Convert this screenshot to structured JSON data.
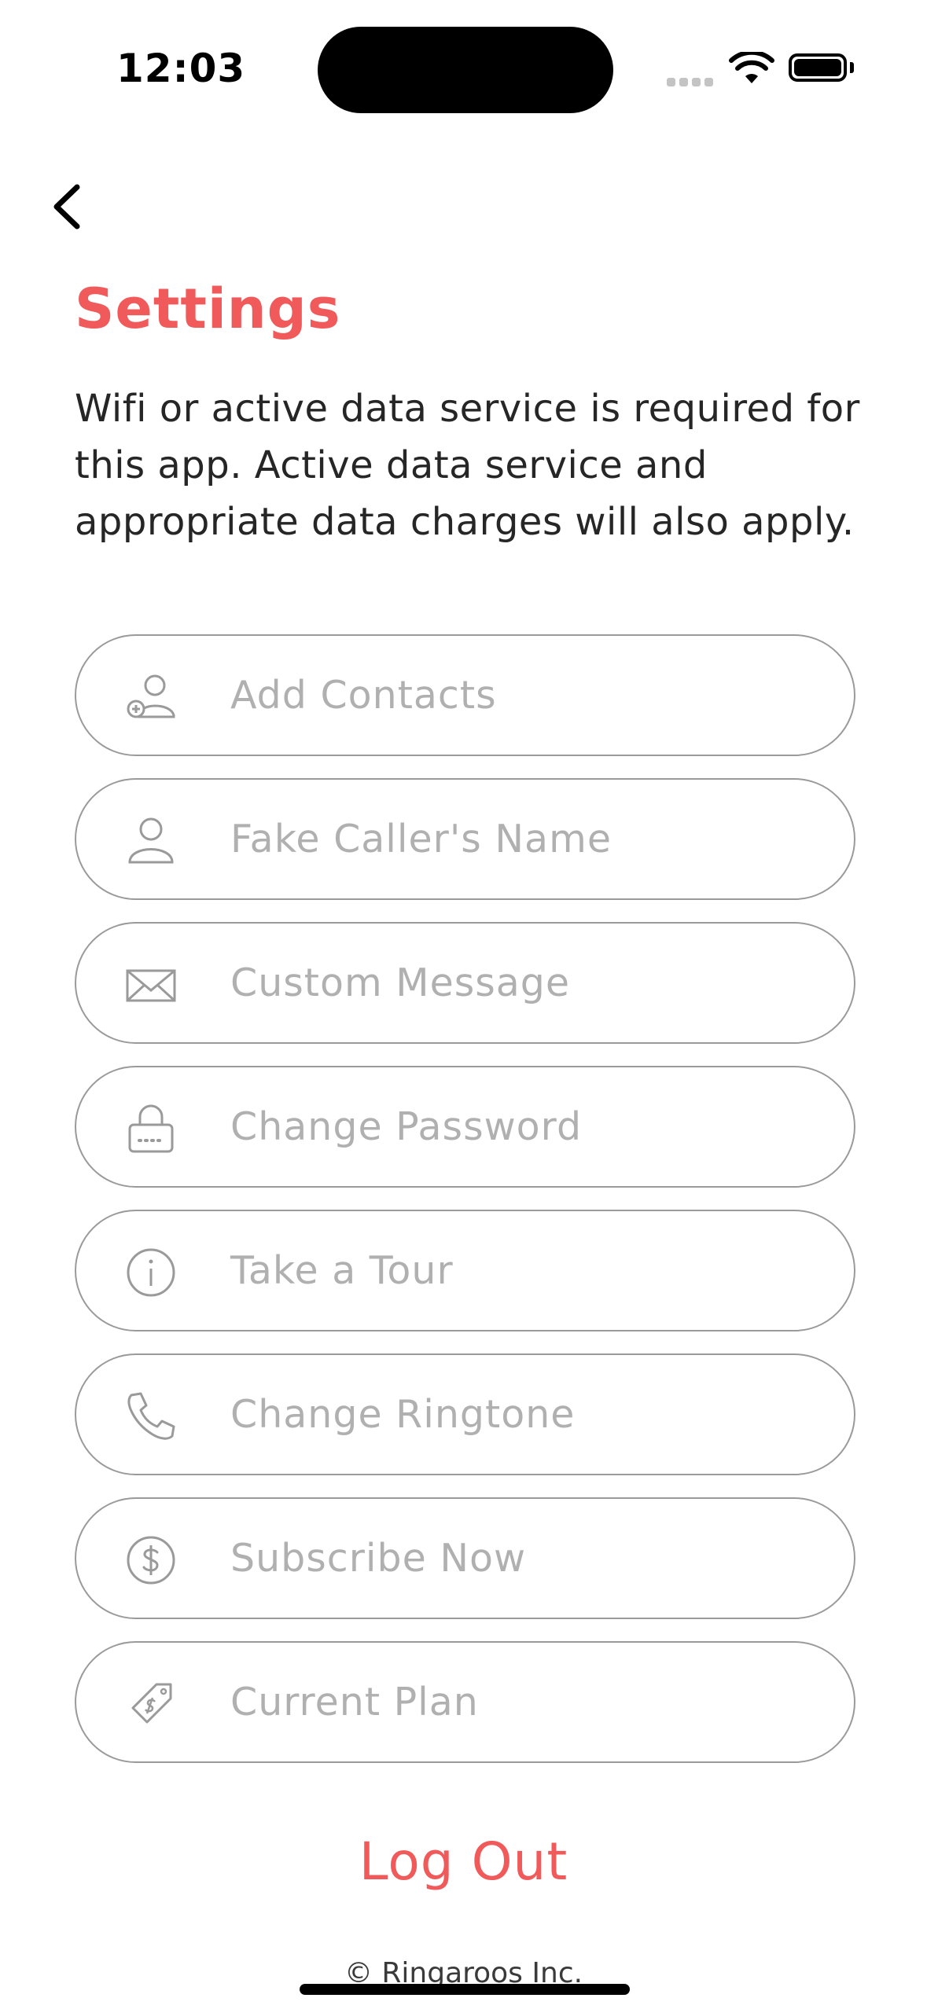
{
  "status_bar": {
    "time": "12:03"
  },
  "header": {
    "title": "Settings"
  },
  "notice": "Wifi or active data service is required for this app. Active data service and appropriate data charges will also apply.",
  "menu": [
    {
      "label": "Add Contacts",
      "icon": "add-contact-icon"
    },
    {
      "label": "Fake Caller's Name",
      "icon": "person-icon"
    },
    {
      "label": "Custom Message",
      "icon": "envelope-icon"
    },
    {
      "label": "Change Password",
      "icon": "lock-icon"
    },
    {
      "label": "Take a Tour",
      "icon": "info-icon"
    },
    {
      "label": "Change Ringtone",
      "icon": "phone-icon"
    },
    {
      "label": "Subscribe Now",
      "icon": "dollar-icon"
    },
    {
      "label": "Current Plan",
      "icon": "price-tag-icon"
    }
  ],
  "logout_label": "Log Out",
  "footer": "© Ringaroos Inc.",
  "colors": {
    "accent": "#f05a5a",
    "border": "#9a9a9a",
    "label": "#b0b0b0"
  }
}
